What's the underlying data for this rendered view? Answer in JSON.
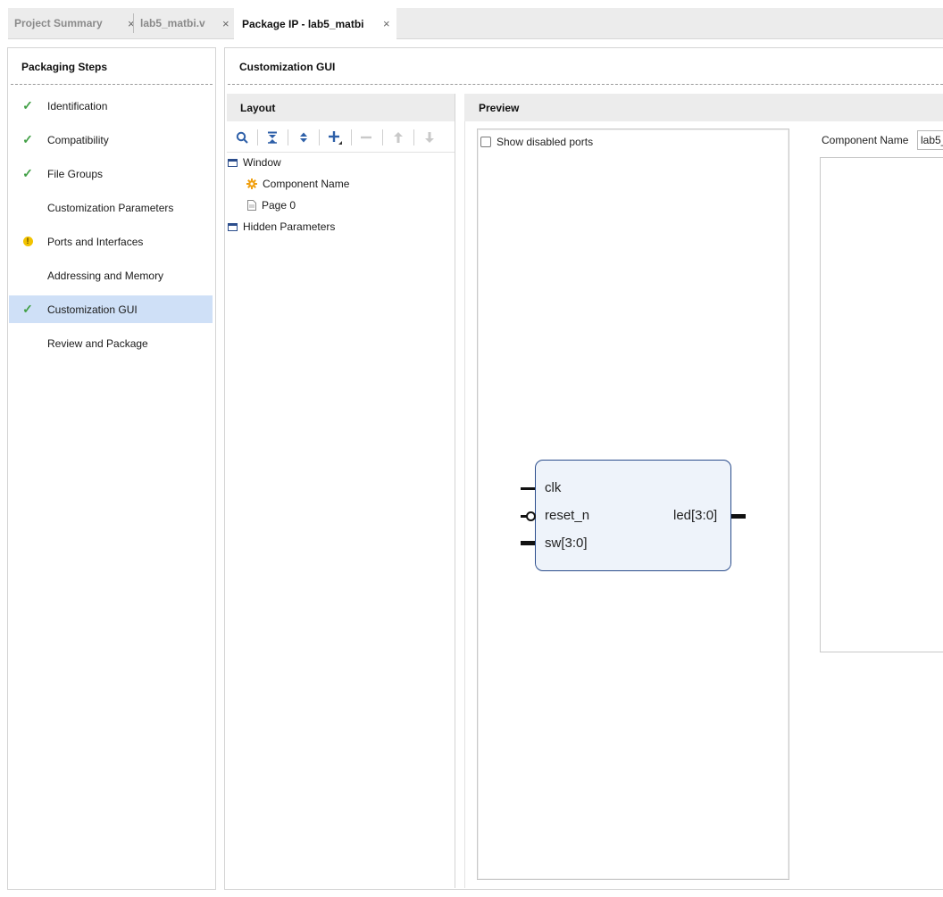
{
  "tabs": [
    {
      "label": "Project Summary",
      "close": "×"
    },
    {
      "label": "lab5_matbi.v",
      "close": "×"
    },
    {
      "label": "Package IP - lab5_matbi",
      "close": "×"
    }
  ],
  "packaging_steps": {
    "title": "Packaging Steps",
    "items": [
      {
        "label": "Identification",
        "status": "check"
      },
      {
        "label": "Compatibility",
        "status": "check"
      },
      {
        "label": "File Groups",
        "status": "check"
      },
      {
        "label": "Customization Parameters",
        "status": "none"
      },
      {
        "label": "Ports and Interfaces",
        "status": "warning"
      },
      {
        "label": "Addressing and Memory",
        "status": "none"
      },
      {
        "label": "Customization GUI",
        "status": "check",
        "selected": true
      },
      {
        "label": "Review and Package",
        "status": "none"
      }
    ],
    "check_glyph": "✓",
    "warn_glyph": "!"
  },
  "main": {
    "title": "Customization GUI",
    "layout": {
      "title": "Layout",
      "toolbar": [
        {
          "icon": "search-icon",
          "glyph": "⚲",
          "enabled": true
        },
        {
          "icon": "collapse-all-icon",
          "glyph": "⇞",
          "enabled": true
        },
        {
          "icon": "expand-all-icon",
          "glyph": "⇕",
          "enabled": true
        },
        {
          "icon": "add-icon",
          "glyph": "+",
          "enabled": true
        },
        {
          "icon": "remove-icon",
          "glyph": "—",
          "enabled": false
        },
        {
          "icon": "move-up-icon",
          "glyph": "🡅",
          "enabled": false
        },
        {
          "icon": "move-down-icon",
          "glyph": "🡇",
          "enabled": false
        }
      ],
      "tree": [
        {
          "label": "Window",
          "icon": "window-icon",
          "level": 0
        },
        {
          "label": "Component Name",
          "icon": "gear-icon",
          "level": 1
        },
        {
          "label": "Page 0",
          "icon": "page-icon",
          "level": 1
        },
        {
          "label": "Hidden Parameters",
          "icon": "window-icon",
          "level": 0
        }
      ]
    },
    "preview": {
      "title": "Preview",
      "show_disabled_label": "Show disabled ports",
      "show_disabled_checked": false,
      "ports_in": [
        "clk",
        "reset_n",
        "sw[3:0]"
      ],
      "ports_out": [
        "led[3:0]"
      ],
      "component_name_label": "Component Name",
      "component_name_value": "lab5_"
    }
  },
  "colors": {
    "accent_selected": "#cfe0f7",
    "check": "#43a047",
    "warning": "#f2c300",
    "block_fill": "#eef3fa",
    "block_border": "#2b4d8c"
  }
}
